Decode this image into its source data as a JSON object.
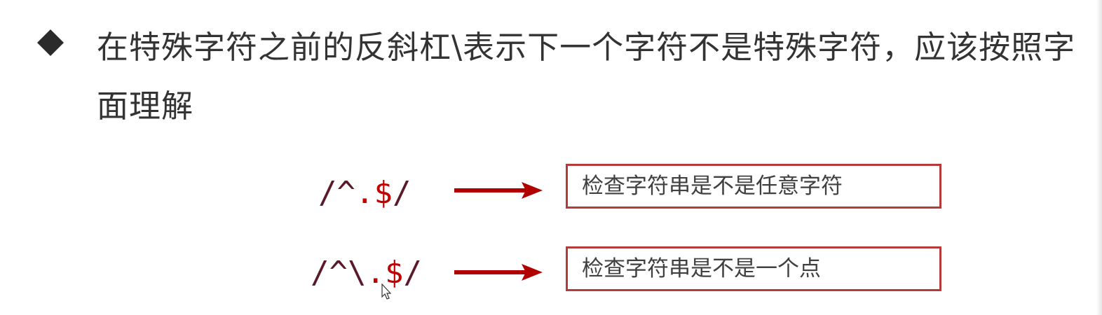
{
  "bullet": {
    "icon": "diamond-bullet-icon",
    "text": "在特殊字符之前的反斜杠\\表示下一个字符不是特殊字符，应该按照字面理解"
  },
  "examples": [
    {
      "regex_prefix": "/^",
      "regex_special": ".$",
      "regex_suffix": "/",
      "description": "检查字符串是不是任意字符"
    },
    {
      "regex_prefix": "/^\\",
      "regex_special": ".$",
      "regex_suffix": "/",
      "description": "检查字符串是不是一个点"
    }
  ],
  "colors": {
    "text": "#333333",
    "regex_dark": "#5a1a2a",
    "regex_red": "#c00000",
    "arrow": "#b00000",
    "box_border": "#b53a3a"
  }
}
